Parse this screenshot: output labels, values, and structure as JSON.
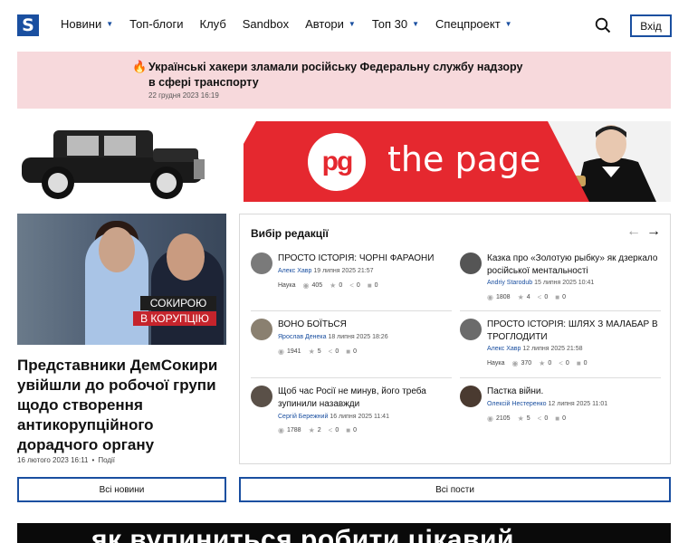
{
  "header": {
    "logo_letter": "S",
    "nav": [
      {
        "label": "Новини",
        "dropdown": true
      },
      {
        "label": "Топ-блоги",
        "dropdown": false
      },
      {
        "label": "Клуб",
        "dropdown": false
      },
      {
        "label": "Sandbox",
        "dropdown": false
      },
      {
        "label": "Автори",
        "dropdown": true
      },
      {
        "label": "Топ 30",
        "dropdown": true
      },
      {
        "label": "Спецпроект",
        "dropdown": true
      }
    ],
    "login_label": "Вхід"
  },
  "breaking": {
    "title": "Українські хакери зламали російську Федеральну службу надзору в сфері транспорту",
    "time": "22 грудня 2023 16:19"
  },
  "ad": {
    "logo_text": "pg",
    "text": "the page"
  },
  "feature": {
    "badge_line1": "СОКИРОЮ",
    "badge_line2": "В КОРУПЦІЮ",
    "title": "Представники ДемСокири увійшли до робочої групи щодо створення антикорупційного дорадчого органу",
    "date": "16 лютого 2023 16:11",
    "category": "Події"
  },
  "editors": {
    "title": "Вибір редакції",
    "posts": [
      {
        "title": "ПРОСТО ІСТОРІЯ: ЧОРНІ ФАРАОНИ",
        "author": "Алекс Хавр",
        "date": "19 липня 2025 21:57",
        "category": "Наука",
        "views": "405",
        "rating": "0",
        "shares": "0",
        "comments": "0"
      },
      {
        "title": "Казка про «Золотую рыбку» як дзеркало російської ментальності",
        "author": "Andriy Starodub",
        "date": "15 липня 2025 10:41",
        "category": "",
        "views": "1808",
        "rating": "4",
        "shares": "0",
        "comments": "0"
      },
      {
        "title": "ВОНО БОЇТЬСЯ",
        "author": "Ярослав Денека",
        "date": "18 липня 2025 18:26",
        "category": "",
        "views": "1941",
        "rating": "5",
        "shares": "0",
        "comments": "0"
      },
      {
        "title": "ПРОСТО ІСТОРІЯ: ШЛЯХ З МАЛАБАР В ТРОГЛОДИТИ",
        "author": "Алекс Хавр",
        "date": "12 липня 2025 21:58",
        "category": "Наука",
        "views": "370",
        "rating": "0",
        "shares": "0",
        "comments": "0"
      },
      {
        "title": "Щоб час Росії не минув, його треба зупинили назавжди",
        "author": "Сергій Бережний",
        "date": "16 липня 2025 11:41",
        "category": "",
        "views": "1788",
        "rating": "2",
        "shares": "0",
        "comments": "0"
      },
      {
        "title": "Пастка війни.",
        "author": "Олексій Нестеренко",
        "date": "12 липня 2025 11:01",
        "category": "",
        "views": "2105",
        "rating": "5",
        "shares": "0",
        "comments": "0"
      }
    ]
  },
  "buttons": {
    "all_news": "Всі новини",
    "all_posts": "Всі пости"
  },
  "bottom_banner": {
    "text": "як вупиниться робити цікавий"
  },
  "colors": {
    "accent": "#1a4fa0",
    "breaking_bg": "#f7d9dc",
    "ad_red": "#e5282f"
  }
}
